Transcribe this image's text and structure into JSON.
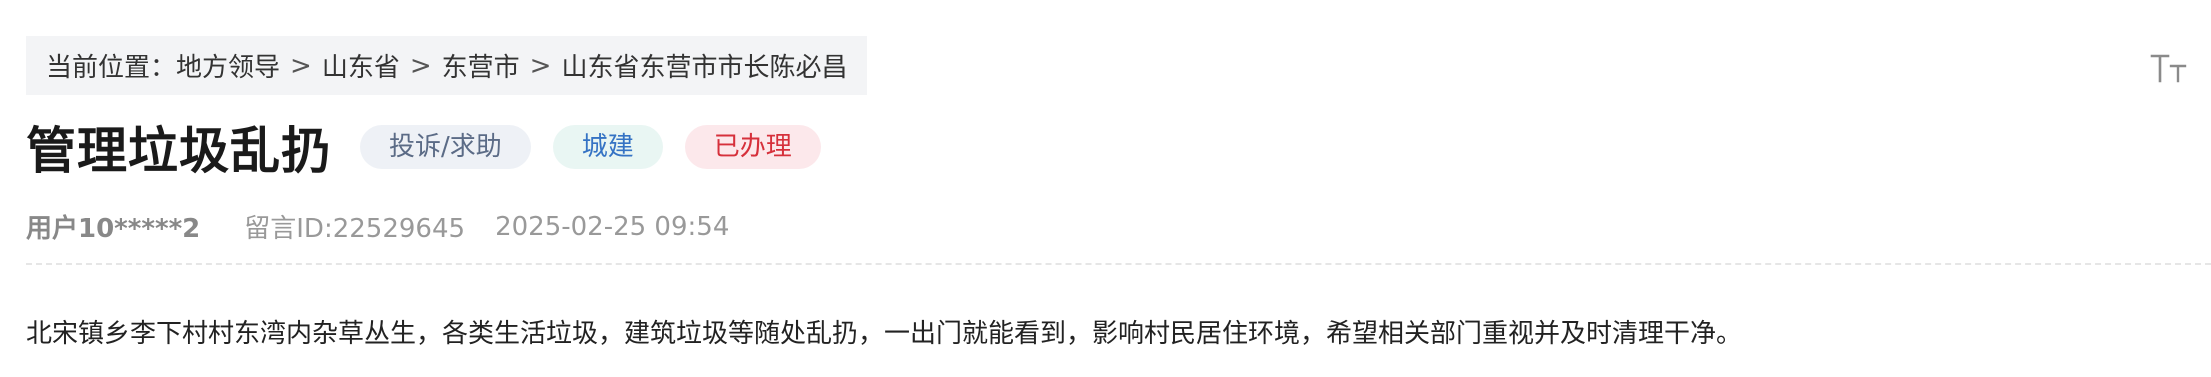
{
  "breadcrumb": {
    "prefix": "当前位置：",
    "items": [
      "地方领导",
      "山东省",
      "东营市",
      "山东省东营市市长陈必昌"
    ],
    "separator": ">"
  },
  "toolbar": {
    "font_size_icon": "text-size-icon"
  },
  "post": {
    "title": "管理垃圾乱扔",
    "tags": {
      "type": "投诉/求助",
      "department": "城建",
      "status": "已办理"
    },
    "user": "用户10*****2",
    "message_id": "留言ID:22529645",
    "datetime": "2025-02-25 09:54",
    "content": "北宋镇乡李下村村东湾内杂草丛生，各类生活垃圾，建筑垃圾等随处乱扔，一出门就能看到，影响村民居住环境，希望相关部门重视并及时清理干净。"
  },
  "colors": {
    "tag_type_bg": "#eef1f6",
    "tag_type_text": "#5b6b86",
    "tag_dept_bg": "#e9f6f3",
    "tag_dept_text": "#3573c4",
    "tag_status_bg": "#fce8eb",
    "tag_status_text": "#d6303b"
  }
}
